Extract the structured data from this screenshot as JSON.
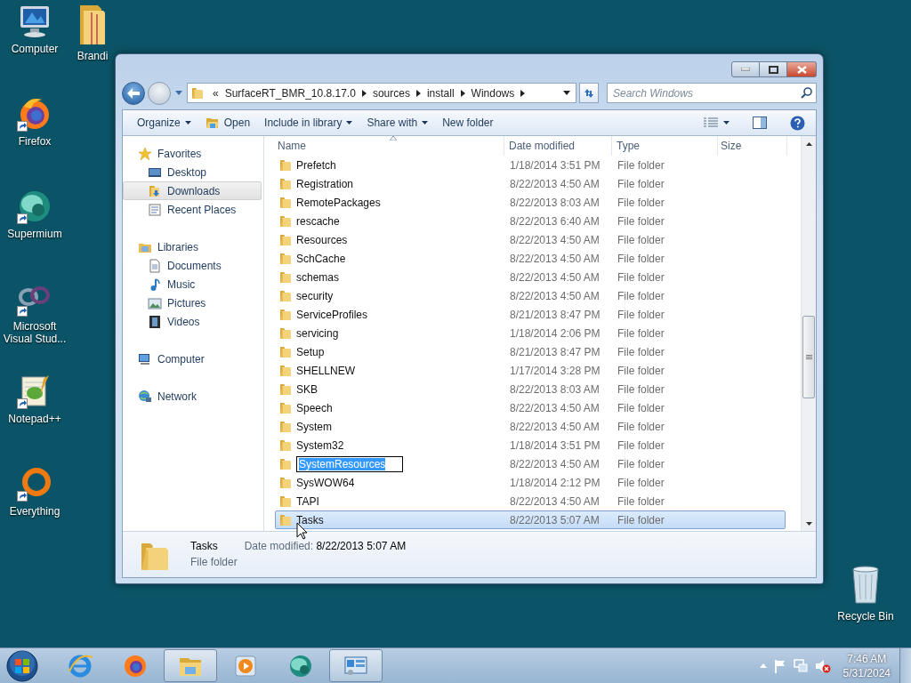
{
  "desktop": {
    "icon_columns": [
      [
        {
          "label": "Computer",
          "kind": "computer",
          "shortcut": false
        },
        {
          "label": "Firefox",
          "kind": "firefox",
          "shortcut": true
        },
        {
          "label": "Supermium",
          "kind": "supermium",
          "shortcut": true
        },
        {
          "label": "Microsoft Visual Stud...",
          "kind": "visual-studio",
          "shortcut": true
        },
        {
          "label": "Notepad++",
          "kind": "notepad",
          "shortcut": true
        },
        {
          "label": "Everything",
          "kind": "everything",
          "shortcut": true
        }
      ],
      [
        {
          "label": "Brandi",
          "kind": "folder",
          "shortcut": false
        }
      ]
    ],
    "corner_icons": [
      {
        "label": "Recycle Bin",
        "kind": "recycle-bin",
        "shortcut": false
      }
    ]
  },
  "window": {
    "address": {
      "overflow": "«",
      "segments": [
        "SurfaceRT_BMR_10.8.17.0",
        "sources",
        "install",
        "Windows"
      ]
    },
    "search": {
      "placeholder": "Search Windows"
    },
    "toolbar": [
      {
        "label": "Organize",
        "kind": "menu",
        "dropdown": true
      },
      {
        "label": "Open",
        "kind": "open",
        "dropdown": false
      },
      {
        "label": "Include in library",
        "kind": "menu",
        "dropdown": true
      },
      {
        "label": "Share with",
        "kind": "menu",
        "dropdown": true
      },
      {
        "label": "New folder",
        "kind": "command",
        "dropdown": false
      }
    ],
    "navigation": [
      {
        "label": "Favorites",
        "kind": "star",
        "selected": false,
        "children": [
          {
            "label": "Desktop",
            "kind": "desktop",
            "selected": false
          },
          {
            "label": "Downloads",
            "kind": "downloads",
            "selected": true
          },
          {
            "label": "Recent Places",
            "kind": "recent",
            "selected": false
          }
        ]
      },
      {
        "label": "Libraries",
        "kind": "library",
        "selected": false,
        "children": [
          {
            "label": "Documents",
            "kind": "document",
            "selected": false
          },
          {
            "label": "Music",
            "kind": "music",
            "selected": false
          },
          {
            "label": "Pictures",
            "kind": "pictures",
            "selected": false
          },
          {
            "label": "Videos",
            "kind": "videos",
            "selected": false
          }
        ]
      },
      {
        "label": "Computer",
        "kind": "computer",
        "selected": false
      },
      {
        "label": "Network",
        "kind": "network",
        "selected": false
      }
    ],
    "columns": [
      {
        "label": "Name",
        "sorted": true
      },
      {
        "label": "Date modified",
        "sorted": false
      },
      {
        "label": "Type",
        "sorted": false
      },
      {
        "label": "Size",
        "sorted": false
      }
    ],
    "rows": [
      {
        "name": "Prefetch",
        "date": "1/18/2014 3:51 PM",
        "type": "File folder",
        "selected": false,
        "renaming": false
      },
      {
        "name": "Registration",
        "date": "8/22/2013 4:50 AM",
        "type": "File folder",
        "selected": false,
        "renaming": false
      },
      {
        "name": "RemotePackages",
        "date": "8/22/2013 8:03 AM",
        "type": "File folder",
        "selected": false,
        "renaming": false
      },
      {
        "name": "rescache",
        "date": "8/22/2013 6:40 AM",
        "type": "File folder",
        "selected": false,
        "renaming": false
      },
      {
        "name": "Resources",
        "date": "8/22/2013 4:50 AM",
        "type": "File folder",
        "selected": false,
        "renaming": false
      },
      {
        "name": "SchCache",
        "date": "8/22/2013 4:50 AM",
        "type": "File folder",
        "selected": false,
        "renaming": false
      },
      {
        "name": "schemas",
        "date": "8/22/2013 4:50 AM",
        "type": "File folder",
        "selected": false,
        "renaming": false
      },
      {
        "name": "security",
        "date": "8/22/2013 4:50 AM",
        "type": "File folder",
        "selected": false,
        "renaming": false
      },
      {
        "name": "ServiceProfiles",
        "date": "8/21/2013 8:47 PM",
        "type": "File folder",
        "selected": false,
        "renaming": false
      },
      {
        "name": "servicing",
        "date": "1/18/2014 2:06 PM",
        "type": "File folder",
        "selected": false,
        "renaming": false
      },
      {
        "name": "Setup",
        "date": "8/21/2013 8:47 PM",
        "type": "File folder",
        "selected": false,
        "renaming": false
      },
      {
        "name": "SHELLNEW",
        "date": "1/17/2014 3:28 PM",
        "type": "File folder",
        "selected": false,
        "renaming": false
      },
      {
        "name": "SKB",
        "date": "8/22/2013 8:03 AM",
        "type": "File folder",
        "selected": false,
        "renaming": false
      },
      {
        "name": "Speech",
        "date": "8/22/2013 4:50 AM",
        "type": "File folder",
        "selected": false,
        "renaming": false
      },
      {
        "name": "System",
        "date": "8/22/2013 4:50 AM",
        "type": "File folder",
        "selected": false,
        "renaming": false
      },
      {
        "name": "System32",
        "date": "1/18/2014 3:51 PM",
        "type": "File folder",
        "selected": false,
        "renaming": false
      },
      {
        "name": "SystemResources",
        "date": "8/22/2013 4:50 AM",
        "type": "File folder",
        "selected": false,
        "renaming": true
      },
      {
        "name": "SysWOW64",
        "date": "1/18/2014 2:12 PM",
        "type": "File folder",
        "selected": false,
        "renaming": false
      },
      {
        "name": "TAPI",
        "date": "8/22/2013 4:50 AM",
        "type": "File folder",
        "selected": false,
        "renaming": false
      },
      {
        "name": "Tasks",
        "date": "8/22/2013 5:07 AM",
        "type": "File folder",
        "selected": true,
        "renaming": false
      }
    ],
    "details": {
      "name": "Tasks",
      "date_label": "Date modified:",
      "date": "8/22/2013 5:07 AM",
      "type": "File folder"
    }
  },
  "taskbar": {
    "apps": [
      {
        "kind": "internet-explorer",
        "active": false
      },
      {
        "kind": "firefox",
        "active": false
      },
      {
        "kind": "explorer",
        "active": true
      },
      {
        "kind": "media-player",
        "active": false
      },
      {
        "kind": "supermium",
        "active": false
      },
      {
        "kind": "control-panel",
        "active": true
      }
    ],
    "tray": {
      "volume_muted": true,
      "time": "7:46 AM",
      "date": "5/31/2024"
    }
  }
}
